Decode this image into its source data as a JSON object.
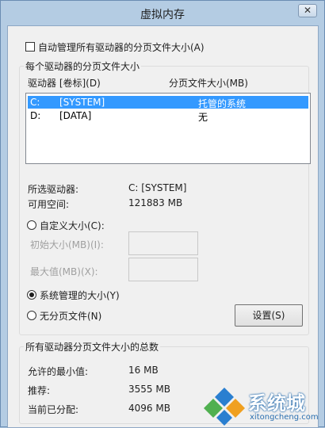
{
  "window": {
    "title": "虚拟内存",
    "close_glyph": "✕"
  },
  "auto_manage": {
    "label": "自动管理所有驱动器的分页文件大小(A)",
    "checked": false
  },
  "drives_group": {
    "title": "每个驱动器的分页文件大小",
    "col_drive": "驱动器 [卷标](D)",
    "col_size": "分页文件大小(MB)",
    "rows": [
      {
        "drive": "C:",
        "label": "[SYSTEM]",
        "size": "托管的系统",
        "selected": true
      },
      {
        "drive": "D:",
        "label": "[DATA]",
        "size": "无",
        "selected": false
      }
    ],
    "selected_drive_label": "所选驱动器:",
    "selected_drive_value": "C:  [SYSTEM]",
    "free_space_label": "可用空间:",
    "free_space_value": "121883 MB",
    "custom_size_label": "自定义大小(C):",
    "initial_size_label": "初始大小(MB)(I):",
    "max_size_label": "最大值(MB)(X):",
    "system_managed_label": "系统管理的大小(Y)",
    "no_paging_label": "无分页文件(N)",
    "set_button": "设置(S)",
    "selected_option": "system_managed"
  },
  "totals_group": {
    "title": "所有驱动器分页文件大小的总数",
    "min_label": "允许的最小值:",
    "min_value": "16 MB",
    "recommended_label": "推荐:",
    "recommended_value": "3555 MB",
    "current_label": "当前已分配:",
    "current_value": "4096 MB"
  },
  "watermark": {
    "text": "系统城",
    "url": "xitongcheng.com"
  },
  "colors": {
    "selection": "#3399ff",
    "frame": "#b4cce3"
  }
}
